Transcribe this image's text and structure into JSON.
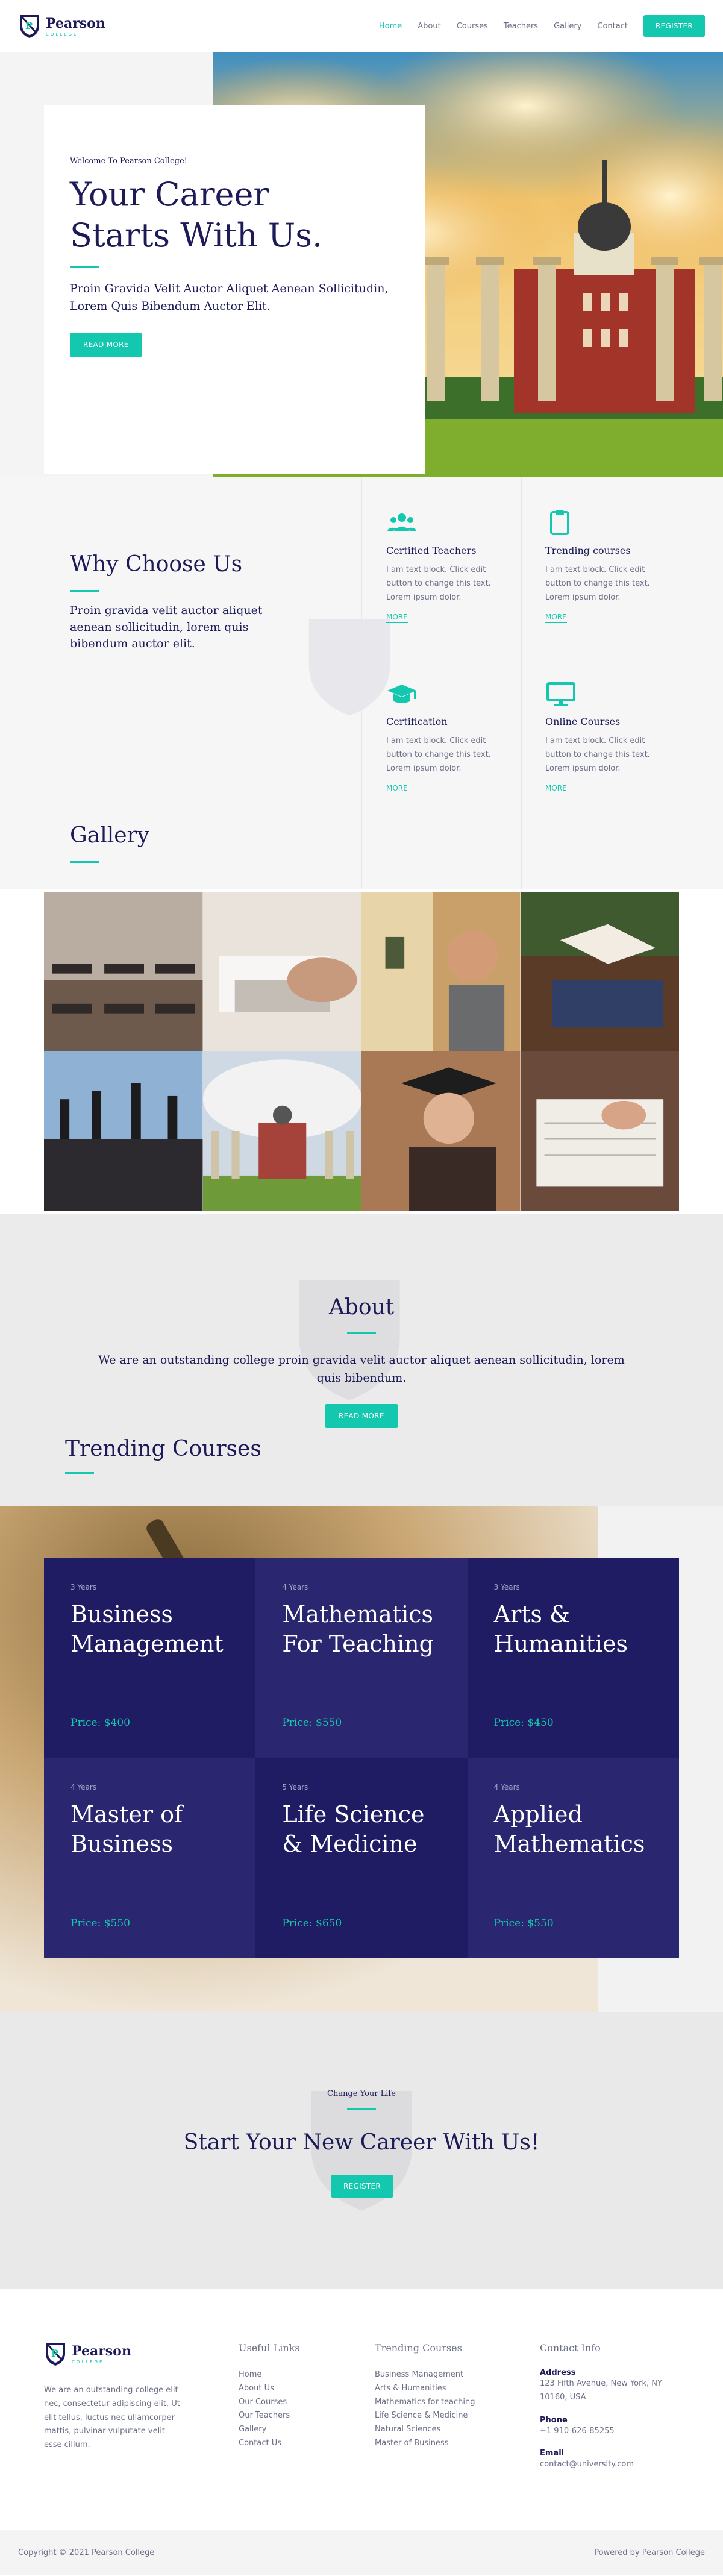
{
  "header": {
    "brand_name": "Pearson",
    "brand_sub": "COLLEGE",
    "nav": [
      {
        "label": "Home",
        "active": true
      },
      {
        "label": "About",
        "active": false
      },
      {
        "label": "Courses",
        "active": false
      },
      {
        "label": "Teachers",
        "active": false
      },
      {
        "label": "Gallery",
        "active": false
      },
      {
        "label": "Contact",
        "active": false
      }
    ],
    "register_label": "REGISTER"
  },
  "hero": {
    "kicker": "Welcome To Pearson College!",
    "title_line1": "Your Career",
    "title_line2": "Starts With Us.",
    "text": "Proin Gravida Velit Auctor Aliquet Aenean Sollicitudin, Lorem Quis Bibendum Auctor Elit.",
    "button": "READ MORE"
  },
  "why": {
    "title": "Why Choose Us",
    "text": "Proin gravida velit auctor aliquet aenean sollicitudin, lorem quis bibendum auctor elit.",
    "features": [
      {
        "icon": "teachers-icon",
        "title": "Certified Teachers",
        "text": "I am text block. Click edit button to change this text. Lorem ipsum dolor.",
        "more": "MORE"
      },
      {
        "icon": "clipboard-icon",
        "title": "Trending courses",
        "text": "I am text block. Click edit button to change this text. Lorem ipsum dolor.",
        "more": "MORE"
      },
      {
        "icon": "graduation-cap-icon",
        "title": "Certification",
        "text": "I am text block. Click edit button to change this text. Lorem ipsum dolor.",
        "more": "MORE"
      },
      {
        "icon": "monitor-icon",
        "title": "Online Courses",
        "text": "I am text block. Click edit button to change this text. Lorem ipsum dolor.",
        "more": "MORE"
      }
    ]
  },
  "gallery": {
    "title": "Gallery"
  },
  "about": {
    "title": "About",
    "text": "We are an outstanding college proin gravida velit auctor aliquet aenean sollicitudin, lorem quis bibendum.",
    "button": "READ MORE"
  },
  "trending": {
    "title": "Trending Courses",
    "courses": [
      {
        "duration": "3 Years",
        "title": "Business Management",
        "price": "Price: $400"
      },
      {
        "duration": "4 Years",
        "title": "Mathematics For Teaching",
        "price": "Price: $550"
      },
      {
        "duration": "3 Years",
        "title": "Arts & Humanities",
        "price": "Price: $450"
      },
      {
        "duration": "4 Years",
        "title": "Master of Business",
        "price": "Price: $550"
      },
      {
        "duration": "5 Years",
        "title": "Life Science & Medicine",
        "price": "Price: $650"
      },
      {
        "duration": "4 Years",
        "title": "Applied Mathematics",
        "price": "Price: $550"
      }
    ]
  },
  "cta": {
    "kicker": "Change Your Life",
    "title": "Start Your New Career With Us!",
    "button": "REGISTER"
  },
  "footer": {
    "brand_name": "Pearson",
    "brand_sub": "COLLEGE",
    "about": "We are an outstanding college elit nec, consectetur adipiscing elit. Ut elit tellus, luctus nec ullamcorper mattis, pulvinar vulputate velit esse cillum.",
    "useful_links_title": "Useful Links",
    "useful_links": [
      "Home",
      "About Us",
      "Our Courses",
      "Our Teachers",
      "Gallery",
      "Contact Us"
    ],
    "trending_title": "Trending Courses",
    "trending_links": [
      "Business Management",
      "Arts & Humanities",
      "Mathematics for teaching",
      "Life Science & Medicine",
      "Natural Sciences",
      "Master of Business"
    ],
    "contact_title": "Contact Info",
    "address_label": "Address",
    "address": "123 Fifth Avenue, New York, NY 10160, USA",
    "phone_label": "Phone",
    "phone": "+1 910-626-85255",
    "email_label": "Email",
    "email": "contact@university.com",
    "copyright": "Copyright © 2021 Pearson College",
    "powered": "Powered by Pearson College"
  },
  "colors": {
    "accent": "#14c8b0",
    "navy": "#1c1b58",
    "course_dark": "#1f1c63",
    "course_light": "#2a2670"
  }
}
